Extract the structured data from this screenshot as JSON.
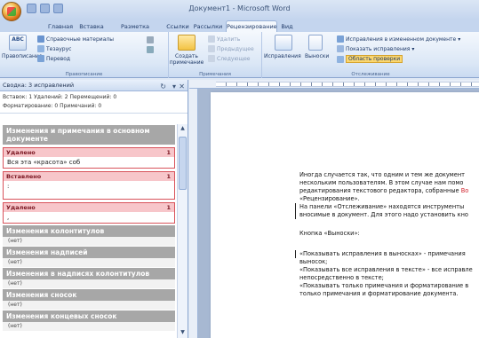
{
  "window": {
    "title": "Документ1 - Microsoft Word"
  },
  "tabs": [
    {
      "label": "Главная"
    },
    {
      "label": "Вставка"
    },
    {
      "label": "Разметка страницы"
    },
    {
      "label": "Ссылки"
    },
    {
      "label": "Рассылки"
    },
    {
      "label": "Рецензирование"
    },
    {
      "label": "Вид"
    }
  ],
  "ribbon": {
    "proofing": {
      "spelling": "Правописание",
      "research": "Справочные материалы",
      "thesaurus": "Тезаурус",
      "translate": "Перевод",
      "group": "Правописание"
    },
    "comments": {
      "new": "Создать примечание",
      "delete": "Удалить",
      "previous": "Предыдущее",
      "next": "Следующее",
      "group": "Примечания"
    },
    "tracking": {
      "track": "Исправления",
      "balloons": "Выноски",
      "display": "Исправления в измененном документе",
      "show_markup": "Показать исправления",
      "reviewing_pane": "Область проверки",
      "group": "Отслеживание"
    }
  },
  "pane": {
    "title": "Сводка: 3 исправлений",
    "summary_line1": "Вставок: 1 Удалений: 2 Перемещений: 0",
    "summary_line2": "Форматирование: 0 Примечаний: 0",
    "main_section": "Изменения и примечания в основном документе",
    "revisions": [
      {
        "type": "Удалено",
        "num": "1",
        "text": "Вся эта «красота» соб"
      },
      {
        "type": "Вставлено",
        "num": "1",
        "text": ":"
      },
      {
        "type": "Удалено",
        "num": "1",
        "text": ","
      }
    ],
    "sections": [
      {
        "title": "Изменения колонтитулов",
        "none": "(нет)"
      },
      {
        "title": "Изменения надписей",
        "none": "(нет)"
      },
      {
        "title": "Изменения в надписях колонтитулов",
        "none": "(нет)"
      },
      {
        "title": "Изменения сносок",
        "none": "(нет)"
      },
      {
        "title": "Изменения концевых сносок",
        "none": "(нет)"
      }
    ]
  },
  "document": {
    "lines": [
      "Иногда случается так, что одним и тем же документ",
      "нескольким пользователям. В этом случае нам помо",
      "редактирования текстового редактора, собранные ",
      "«Рецензирование».",
      " На панели «Отслеживание» находятся инструменты",
      "вносимые в документ. Для этого надо установить кно",
      "",
      "Кнопка «Выноски»:",
      "",
      "«Показывать исправления в выносках» - примечания",
      "выносок;",
      "«Показывать все исправления в тексте» - все исправле",
      "непосредственно в тексте;",
      "«Показывать только примечания и форматирование в",
      "только примечания и форматирование документа."
    ],
    "red_word": "Во"
  }
}
